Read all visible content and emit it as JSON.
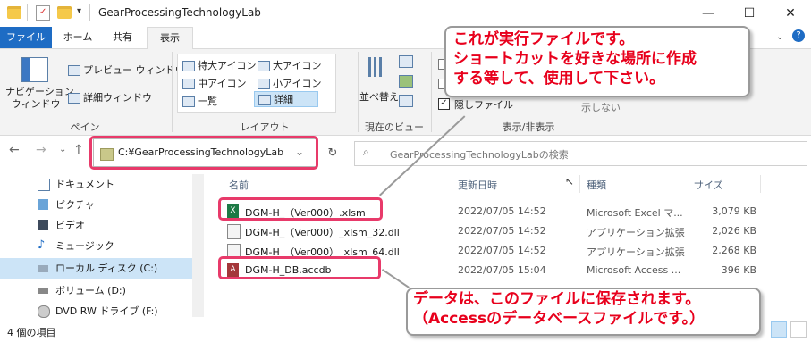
{
  "window": {
    "title": "GearProcessingTechnologyLab",
    "minimize": "—",
    "maximize": "☐",
    "close": "✕"
  },
  "ribbon_tabs": [
    "ファイル",
    "ホーム",
    "共有",
    "表示"
  ],
  "ribbon": {
    "nav_pane": "ナビゲーション\nウィンドウ",
    "preview_pane": "プレビュー ウィンドウ",
    "details_pane": "詳細ウィンドウ",
    "group_pane": "ペイン",
    "layout": [
      "特大アイコン",
      "大アイコン",
      "中アイコン",
      "小アイコン",
      "一覧",
      "詳細"
    ],
    "group_layout": "レイアウト",
    "sort": "並べ替え",
    "group_view": "現在のビュー",
    "hidden_files": "隠しファイル",
    "hide_label": "示しない",
    "group_show": "表示/非表示"
  },
  "address": {
    "path": "C:¥GearProcessingTechnologyLab",
    "search_placeholder": "GearProcessingTechnologyLabの検索"
  },
  "nav_items": [
    "ドキュメント",
    "ピクチャ",
    "ビデオ",
    "ミュージック",
    "ローカル ディスク (C:)",
    "ボリューム (D:)",
    "DVD RW ドライブ (F:)"
  ],
  "columns": [
    "名前",
    "更新日時",
    "種類",
    "サイズ"
  ],
  "files": [
    {
      "name": "DGM-H_（Ver000）.xlsm",
      "date": "2022/07/05 14:52",
      "type": "Microsoft Excel マ...",
      "size": "3,079 KB",
      "icon": "excel-icon"
    },
    {
      "name": "DGM-H_（Ver000）_xlsm_32.dll",
      "date": "2022/07/05 14:52",
      "type": "アプリケーション拡張",
      "size": "2,026 KB",
      "icon": "dll-icon"
    },
    {
      "name": "DGM-H_（Ver000）_xlsm_64.dll",
      "date": "2022/07/05 14:52",
      "type": "アプリケーション拡張",
      "size": "2,268 KB",
      "icon": "dll-icon"
    },
    {
      "name": "DGM-H_DB.accdb",
      "date": "2022/07/05 15:04",
      "type": "Microsoft Access ...",
      "size": "396 KB",
      "icon": "access-icon"
    }
  ],
  "status": "4 個の項目",
  "callouts": {
    "top": [
      "これが実行ファイルです。",
      "ショートカットを好きな場所に作成",
      "する等して、使用して下さい。"
    ],
    "bottom": [
      "データは、このファイルに保存されます。",
      "（Accessのデータベースファイルです。）"
    ]
  },
  "colors": {
    "accent": "#1e6cc4",
    "highlight": "#e83a6a",
    "callout_text": "#e8001c"
  }
}
